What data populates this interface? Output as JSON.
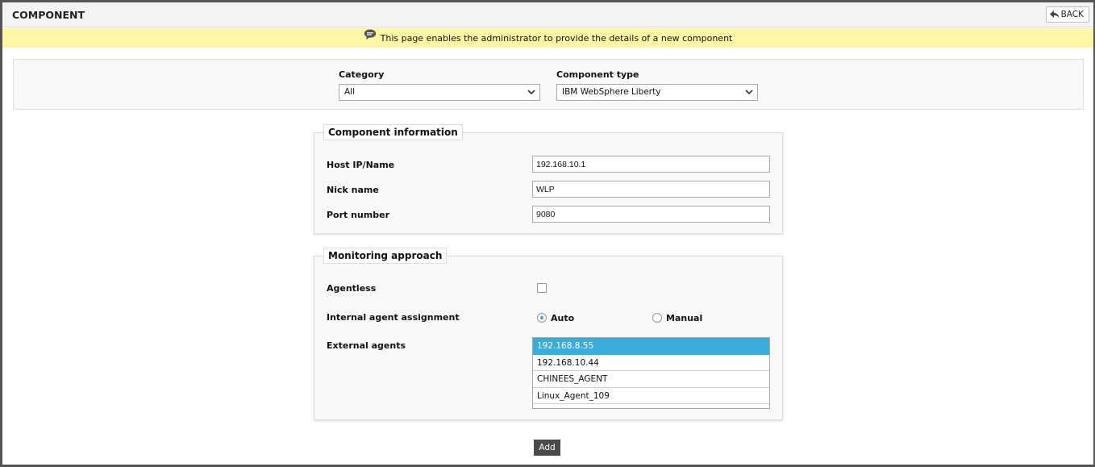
{
  "header": {
    "title": "COMPONENT",
    "back_label": "BACK"
  },
  "info_bar": {
    "message": "This page enables the administrator to provide the details of a new component"
  },
  "filters": {
    "category": {
      "label": "Category",
      "value": "All"
    },
    "component_type": {
      "label": "Component type",
      "value": "IBM WebSphere Liberty"
    }
  },
  "component_info": {
    "legend": "Component information",
    "host": {
      "label": "Host IP/Name",
      "value": "192.168.10.1"
    },
    "nick": {
      "label": "Nick name",
      "value": "WLP"
    },
    "port": {
      "label": "Port number",
      "value": "9080"
    }
  },
  "monitoring": {
    "legend": "Monitoring approach",
    "agentless": {
      "label": "Agentless",
      "checked": false
    },
    "internal_agent": {
      "label": "Internal agent assignment",
      "auto": "Auto",
      "manual": "Manual",
      "selected": "Auto"
    },
    "external_agents": {
      "label": "External agents",
      "items": [
        "192.168.8.55",
        "192.168.10.44",
        "CHINEES_AGENT",
        "Linux_Agent_109"
      ],
      "selected": "192.168.8.55"
    }
  },
  "actions": {
    "add_label": "Add"
  },
  "colors": {
    "info_bar_bg": "#fff6a6",
    "selection": "#3aacdc",
    "add_button_bg": "#4a4a4a"
  }
}
